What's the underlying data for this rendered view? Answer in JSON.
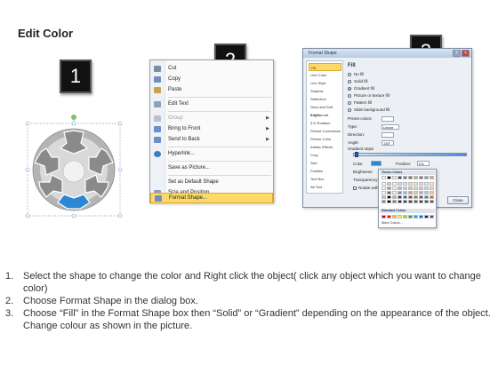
{
  "title": "Edit Color",
  "callouts": [
    "1",
    "2",
    "3"
  ],
  "context_menu": {
    "items": [
      {
        "label": "Cut",
        "icon": "scissors-icon",
        "color": "#7a8ea8"
      },
      {
        "label": "Copy",
        "icon": "copy-icon",
        "color": "#6e8fbf"
      },
      {
        "label": "Paste",
        "icon": "paste-icon",
        "color": "#c9a24a"
      },
      {
        "label": "Edit Text",
        "icon": "edit-text-icon",
        "color": "#8aa0bd"
      },
      {
        "label": "Group",
        "icon": "group-icon",
        "color": "#b8c2cf",
        "disabled": true,
        "submenu": true
      },
      {
        "label": "Bring to Front",
        "icon": "bring-front-icon",
        "color": "#6d8fc7",
        "submenu": true
      },
      {
        "label": "Send to Back",
        "icon": "send-back-icon",
        "color": "#6d8fc7",
        "submenu": true
      },
      {
        "label": "Hyperlink...",
        "icon": "globe-icon",
        "color": "#3d7ac9"
      },
      {
        "label": "Save as Picture...",
        "icon": "",
        "color": ""
      },
      {
        "label": "Set as Default Shape",
        "icon": "",
        "color": ""
      },
      {
        "label": "Size and Position...",
        "icon": "size-icon",
        "color": "#8aa0bd"
      },
      {
        "label": "Format Shape...",
        "icon": "format-shape-icon",
        "color": "#6d8fc7",
        "highlighted": true
      }
    ]
  },
  "dialog": {
    "title": "Format Shape",
    "sidebar": [
      "Fill",
      "Line Color",
      "Line Style",
      "Shadow",
      "Reflection",
      "Glow and Soft Edges",
      "3-D Format",
      "3-D Rotation",
      "Picture Corrections",
      "Picture Color",
      "Artistic Effects",
      "Crop",
      "Size",
      "Position",
      "Text Box",
      "Alt Text"
    ],
    "fill_heading": "Fill",
    "fill_options": [
      {
        "label": "No fill",
        "checked": false
      },
      {
        "label": "Solid fill",
        "checked": false
      },
      {
        "label": "Gradient fill",
        "checked": true
      },
      {
        "label": "Picture or texture fill",
        "checked": false
      },
      {
        "label": "Pattern fill",
        "checked": false
      },
      {
        "label": "Slide background fill",
        "checked": false
      }
    ],
    "fields": [
      {
        "label": "Preset colors:",
        "value": ""
      },
      {
        "label": "Type:",
        "value": "Linear"
      },
      {
        "label": "Direction:",
        "value": ""
      },
      {
        "label": "Angle:",
        "value": "130°"
      }
    ],
    "gradient_stops_label": "Gradient stops",
    "color_label": "Color",
    "position_label": "Position:",
    "position_value": "0%",
    "brightness_label": "Brightness:",
    "transparency_label": "Transparency:",
    "rotate_label": "Rotate with shape",
    "close_label": "Close"
  },
  "color_picker": {
    "theme_header": "Theme Colors",
    "standard_header": "Standard Colors",
    "more_label": "More Colors...",
    "theme_top": [
      "#ffffff",
      "#000000",
      "#eeece1",
      "#1f497d",
      "#4f81bd",
      "#c0504d",
      "#9bbb59",
      "#8064a2",
      "#4bacc6",
      "#f79646"
    ],
    "standard": [
      "#c00000",
      "#ff0000",
      "#ffc000",
      "#ffff00",
      "#92d050",
      "#00b050",
      "#00b0f0",
      "#0070c0",
      "#002060",
      "#7030a0"
    ]
  },
  "steps": [
    {
      "n": "1.",
      "text": "Select the shape to change the color and Right click the object( click any object which you want to change color)"
    },
    {
      "n": "2.",
      "text": "Choose Format Shape in the dialog box."
    },
    {
      "n": "3.",
      "text": "Choose “Fill” in the Format Shape box then “Solid” or “Gradient” depending on the appearance of the object. Change colour as shown in the picture."
    }
  ],
  "colors": {
    "shape_gray": "#9a9a9a",
    "shape_selected": "#2b86d4",
    "menu_highlight": "#fbd96a"
  }
}
